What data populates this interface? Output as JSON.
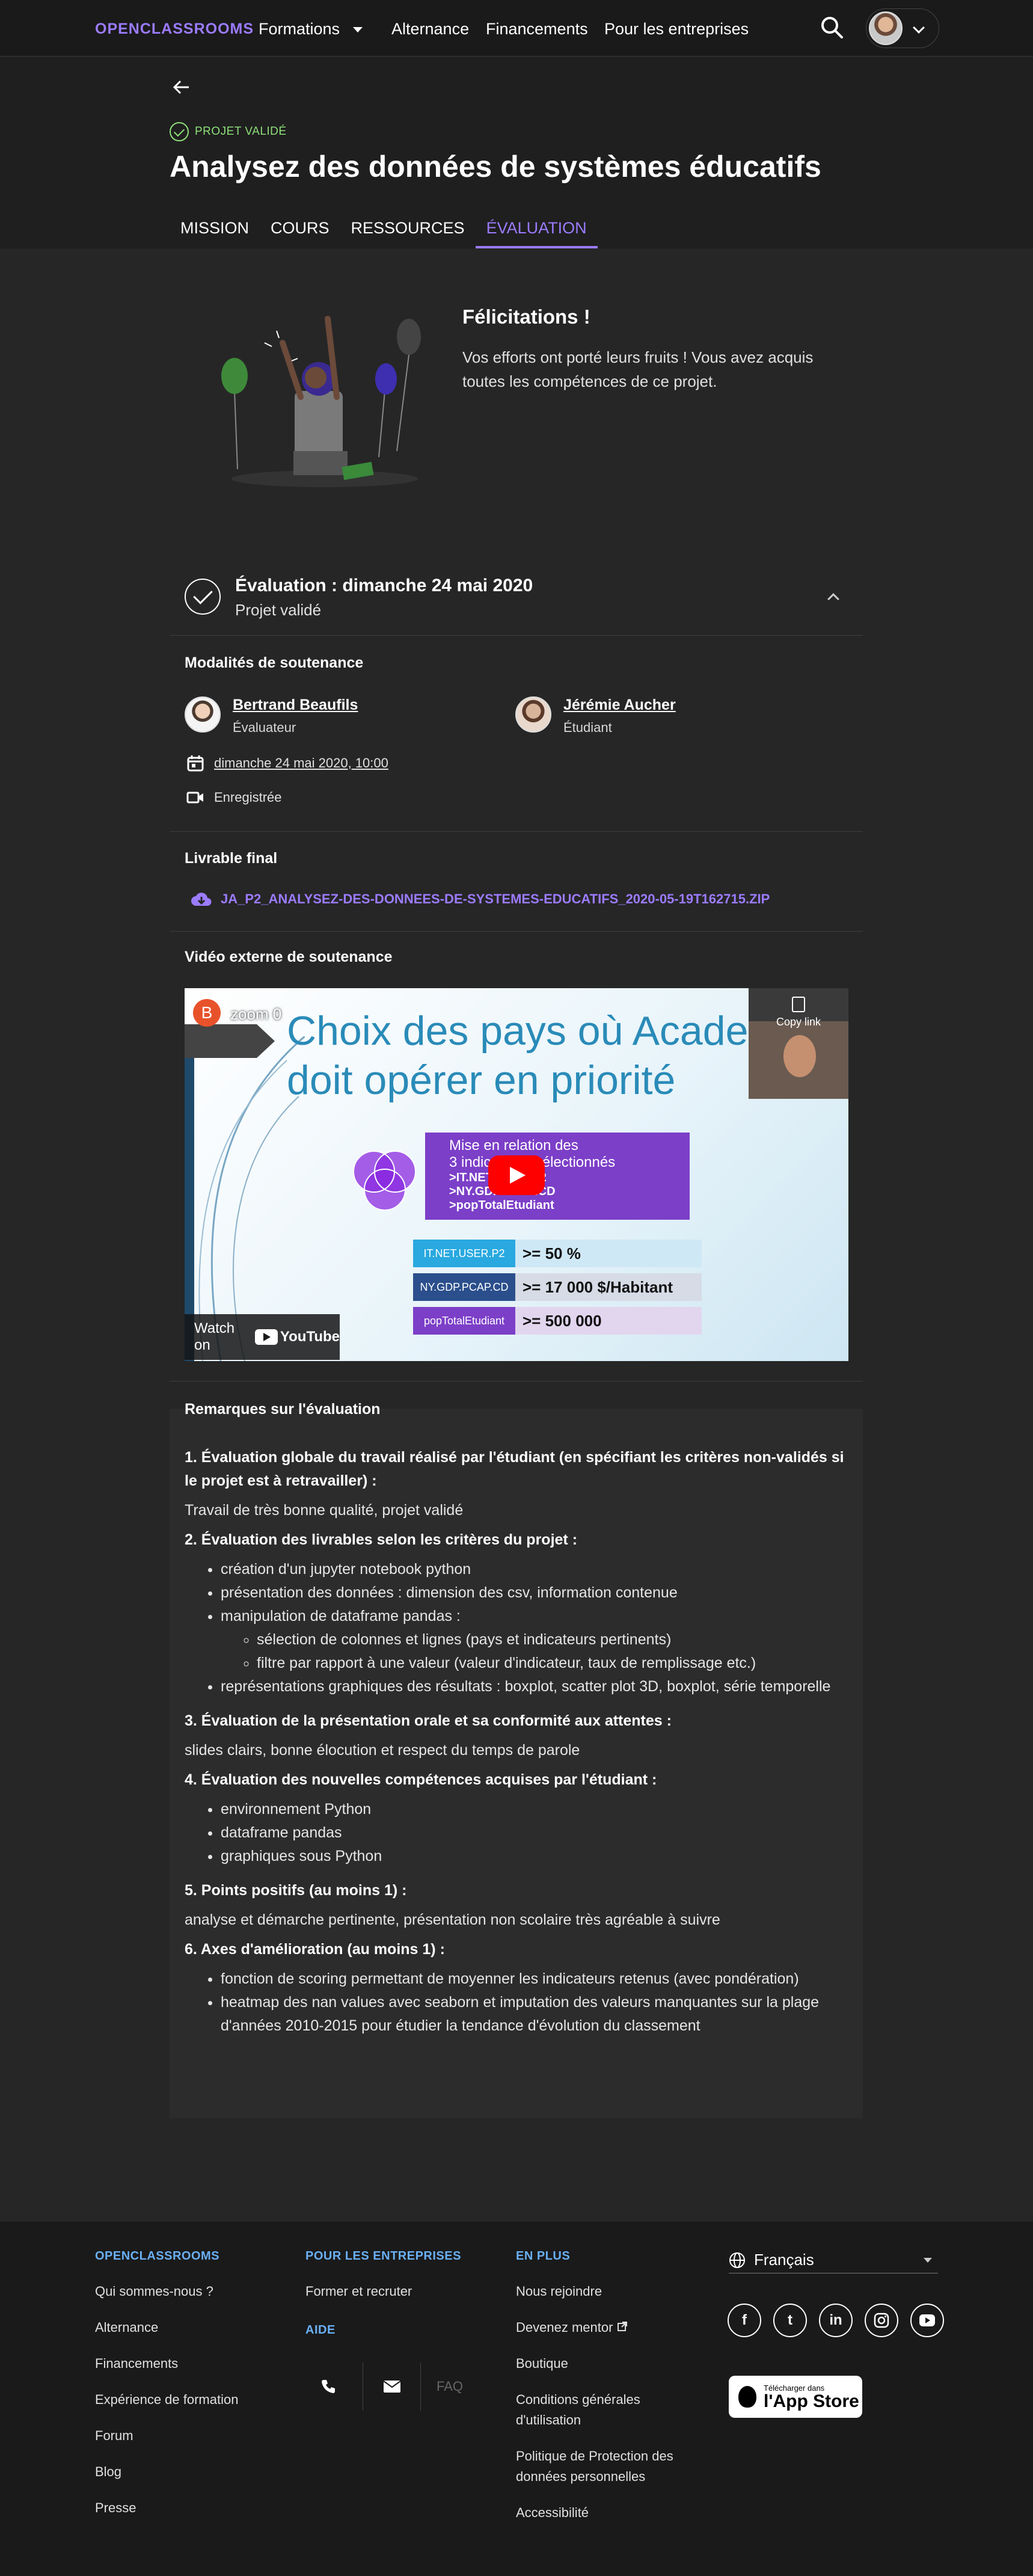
{
  "topnav": {
    "logo": "OPENCLASSROOMS",
    "items": [
      "Formations",
      "Alternance",
      "Financements",
      "Pour les entreprises"
    ]
  },
  "project": {
    "status": "PROJET VALIDÉ",
    "title": "Analysez des données de systèmes éducatifs",
    "tabs": [
      "MISSION",
      "COURS",
      "RESSOURCES",
      "ÉVALUATION"
    ],
    "active_tab": "ÉVALUATION"
  },
  "congrats": {
    "title": "Félicitations !",
    "text": "Vos efforts ont porté leurs fruits ! Vous avez acquis toutes les compétences de ce projet."
  },
  "evaluation": {
    "title": "Évaluation : dimanche 24 mai 2020",
    "subtitle": "Projet validé",
    "modalities": {
      "title": "Modalités de soutenance",
      "evaluator": {
        "name": "Bertrand Beaufils",
        "role": "Évaluateur"
      },
      "student": {
        "name": "Jérémie Aucher",
        "role": "Étudiant"
      },
      "date": "dimanche 24 mai 2020, 10:00",
      "recording": "Enregistrée"
    },
    "deliverable": {
      "title": "Livrable final",
      "file": "JA_P2_ANALYSEZ-DES-DONNEES-DE-SYSTEMES-EDUCATIFS_2020-05-19T162715.ZIP"
    },
    "video": {
      "title": "Vidéo externe de soutenance",
      "channel_initial": "B",
      "video_title": "zoom 0",
      "copy_link": "Copy link",
      "slide_title_1": "Choix des pays où Acade",
      "slide_title_2": "doit opérer en priorité",
      "box_lines": [
        "Mise en relation des",
        "3 indicateurs sélectionnés"
      ],
      "box_items": [
        ">IT.NET.USER.P2",
        ">NY.GDP.PCAP.CD",
        ">popTotalEtudiant"
      ],
      "table": [
        {
          "key": "IT.NET.USER.P2",
          "value": ">= 50 %",
          "color": "#29a9e0",
          "bg": "#cfe8f6"
        },
        {
          "key": "NY.GDP.PCAP.CD",
          "value": ">= 17 000 $/Habitant",
          "color": "#2b4f8c",
          "bg": "#d6dbe6"
        },
        {
          "key": "popTotalEtudiant",
          "value": ">= 500 000",
          "color": "#7c3fc8",
          "bg": "#e2d6ef"
        }
      ],
      "watch_on": "Watch on",
      "youtube": "YouTube"
    },
    "remarks": {
      "title": "Remarques sur l'évaluation",
      "s1_title": "1. Évaluation globale du travail réalisé par l'étudiant (en spécifiant les critères non-validés si le projet est à retravailler) :",
      "s1_text": "Travail de très bonne qualité, projet validé",
      "s2_title": "2. Évaluation des livrables selon les critères du projet :",
      "s2_items": [
        "création d'un jupyter notebook python",
        "présentation des données : dimension des csv, information contenue",
        "manipulation de dataframe pandas :",
        "représentations graphiques des résultats : boxplot, scatter plot 3D, boxplot, série temporelle"
      ],
      "s2_sub_items": [
        "sélection de colonnes et lignes (pays et indicateurs pertinents)",
        "filtre par rapport à une valeur (valeur d'indicateur, taux de remplissage etc.)"
      ],
      "s3_title": "3. Évaluation de la présentation orale et sa conformité aux attentes :",
      "s3_text": "slides clairs, bonne élocution et respect du temps de parole",
      "s4_title": "4. Évaluation des nouvelles compétences acquises par l'étudiant :",
      "s4_items": [
        "environnement Python",
        "dataframe pandas",
        "graphiques sous Python"
      ],
      "s5_title": "5. Points positifs (au moins 1) :",
      "s5_text": "analyse et démarche pertinente, présentation non scolaire très agréable à suivre",
      "s6_title": "6. Axes d'amélioration (au moins 1) :",
      "s6_items": [
        "fonction de scoring permettant de moyenner les indicateurs retenus (avec pondération)",
        "heatmap des nan values avec seaborn et imputation des valeurs manquantes sur la plage d'années 2010-2015 pour étudier la tendance d'évolution du classement"
      ]
    }
  },
  "footer": {
    "col1": {
      "head": "OPENCLASSROOMS",
      "links": [
        "Qui sommes-nous ?",
        "Alternance",
        "Financements",
        "Expérience de formation",
        "Forum",
        "Blog",
        "Presse"
      ]
    },
    "col2": {
      "head": "POUR LES ENTREPRISES",
      "links": [
        "Former et recruter"
      ],
      "help_head": "AIDE",
      "faq": "FAQ"
    },
    "col3": {
      "head": "EN PLUS",
      "links": [
        "Nous rejoindre",
        "Devenez mentor",
        "Boutique",
        "Conditions générales d'utilisation",
        "Politique de Protection des données personnelles",
        "Accessibilité"
      ]
    },
    "language": "Français",
    "socials": [
      "f",
      "t",
      "in",
      "ig",
      "yt"
    ],
    "appstore_small": "Télécharger dans",
    "appstore_big": "l'App Store"
  }
}
